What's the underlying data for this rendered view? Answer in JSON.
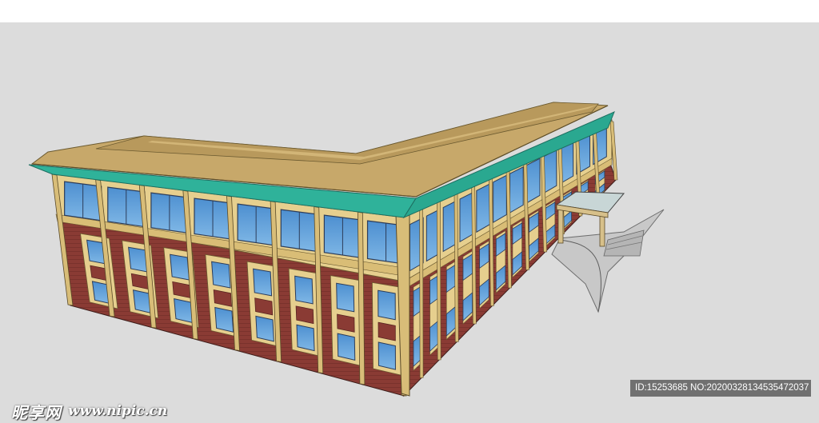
{
  "watermark": {
    "logo_text": "昵享网",
    "url_text": "www.nipic.cn"
  },
  "image_id_banner": {
    "text": "ID:15253685 NO:20200328134535472037"
  },
  "colors": {
    "ground": "#dcdcdc",
    "roof_surface": "#c7a86a",
    "roof_trim": "#2fb29a",
    "brick": "#8a3b34",
    "facade_cream": "#e6cf8e",
    "glass": "#5b9bd5"
  }
}
